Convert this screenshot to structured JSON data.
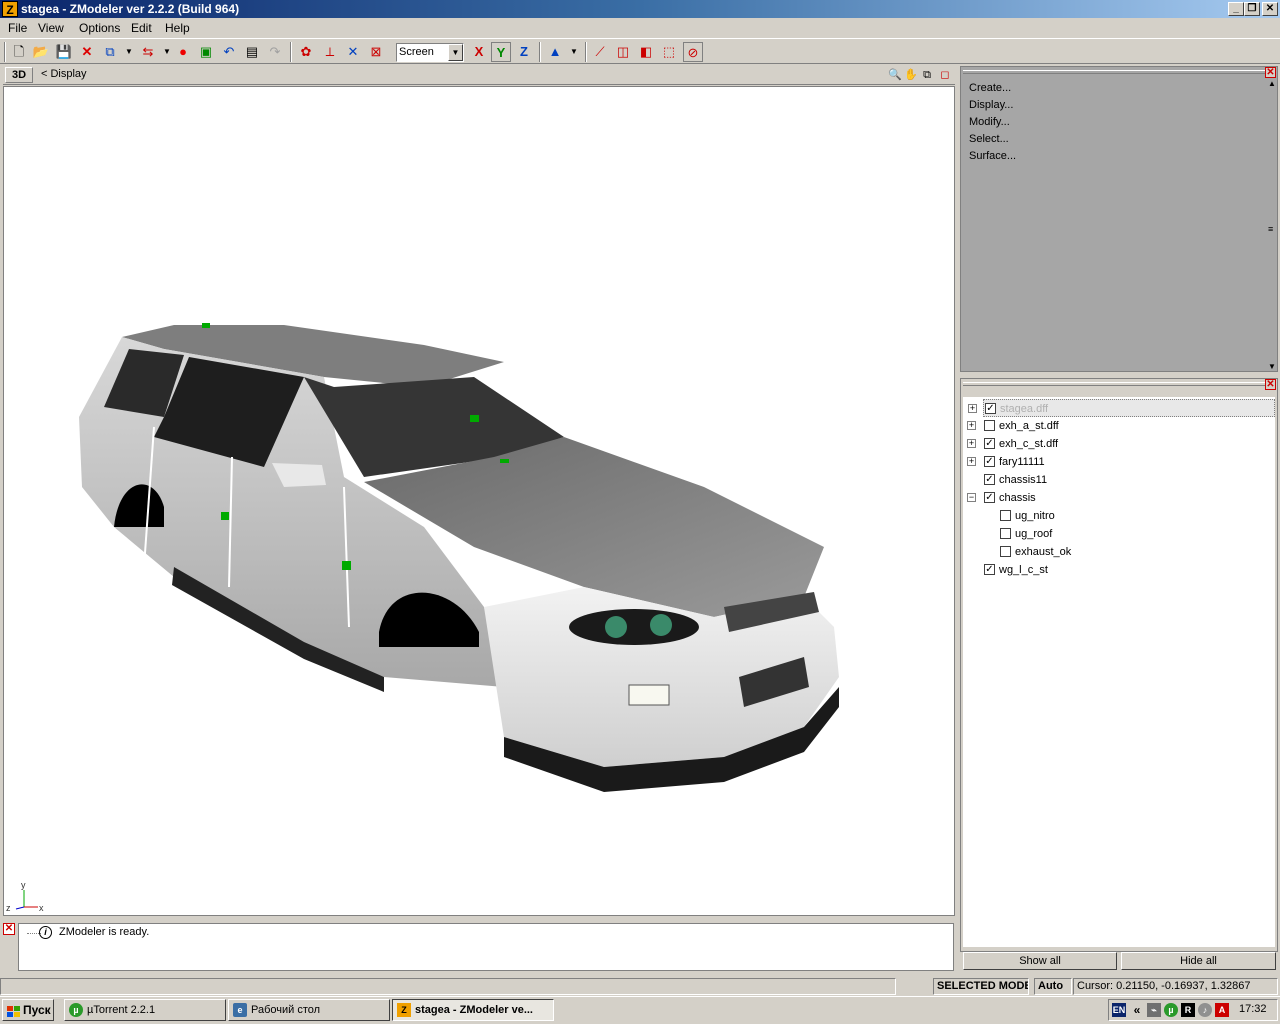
{
  "window": {
    "app_icon": "Z",
    "title": "stagea - ZModeler ver 2.2.2 (Build 964)"
  },
  "menu": [
    {
      "label": "File"
    },
    {
      "label": "View"
    },
    {
      "label": "Options"
    },
    {
      "label": "Edit"
    },
    {
      "label": "Help"
    }
  ],
  "toolbar": {
    "mode_select": "Screen",
    "axis_x": "X",
    "axis_y": "Y",
    "axis_z": "Z"
  },
  "viewport": {
    "type": "3D",
    "mode": "< Display",
    "axis_y": "y",
    "axis_z": "z",
    "axis_x": "x"
  },
  "commands": [
    "Create...",
    "Display...",
    "Modify...",
    "Select...",
    "Surface..."
  ],
  "objects": [
    {
      "name": "stagea.dff",
      "checked": true,
      "expander": "+"
    },
    {
      "name": "exh_a_st.dff",
      "checked": false,
      "expander": "+"
    },
    {
      "name": "exh_c_st.dff",
      "checked": true,
      "expander": "+"
    },
    {
      "name": "fary11111",
      "checked": true,
      "expander": "+"
    },
    {
      "name": "chassis11",
      "checked": true,
      "expander": ""
    },
    {
      "name": "chassis",
      "checked": true,
      "expander": "−"
    },
    {
      "name": "ug_nitro",
      "checked": false,
      "expander": ""
    },
    {
      "name": "ug_roof",
      "checked": false,
      "expander": ""
    },
    {
      "name": "exhaust_ok",
      "checked": false,
      "expander": ""
    },
    {
      "name": "wg_l_c_st",
      "checked": true,
      "expander": ""
    }
  ],
  "buttons": {
    "show_all": "Show all",
    "hide_all": "Hide all"
  },
  "log": {
    "message": "ZModeler is ready."
  },
  "status": {
    "mode": "SELECTED MODE",
    "snap": "Auto",
    "cursor": "Cursor: 0.21150, -0.16937, 1.32867"
  },
  "taskbar": {
    "start": "Пуск",
    "tasks": [
      "µTorrent 2.2.1",
      "Рабочий стол",
      "stagea - ZModeler ve..."
    ],
    "lang": "EN",
    "chevron": "«",
    "clock": "17:32"
  }
}
